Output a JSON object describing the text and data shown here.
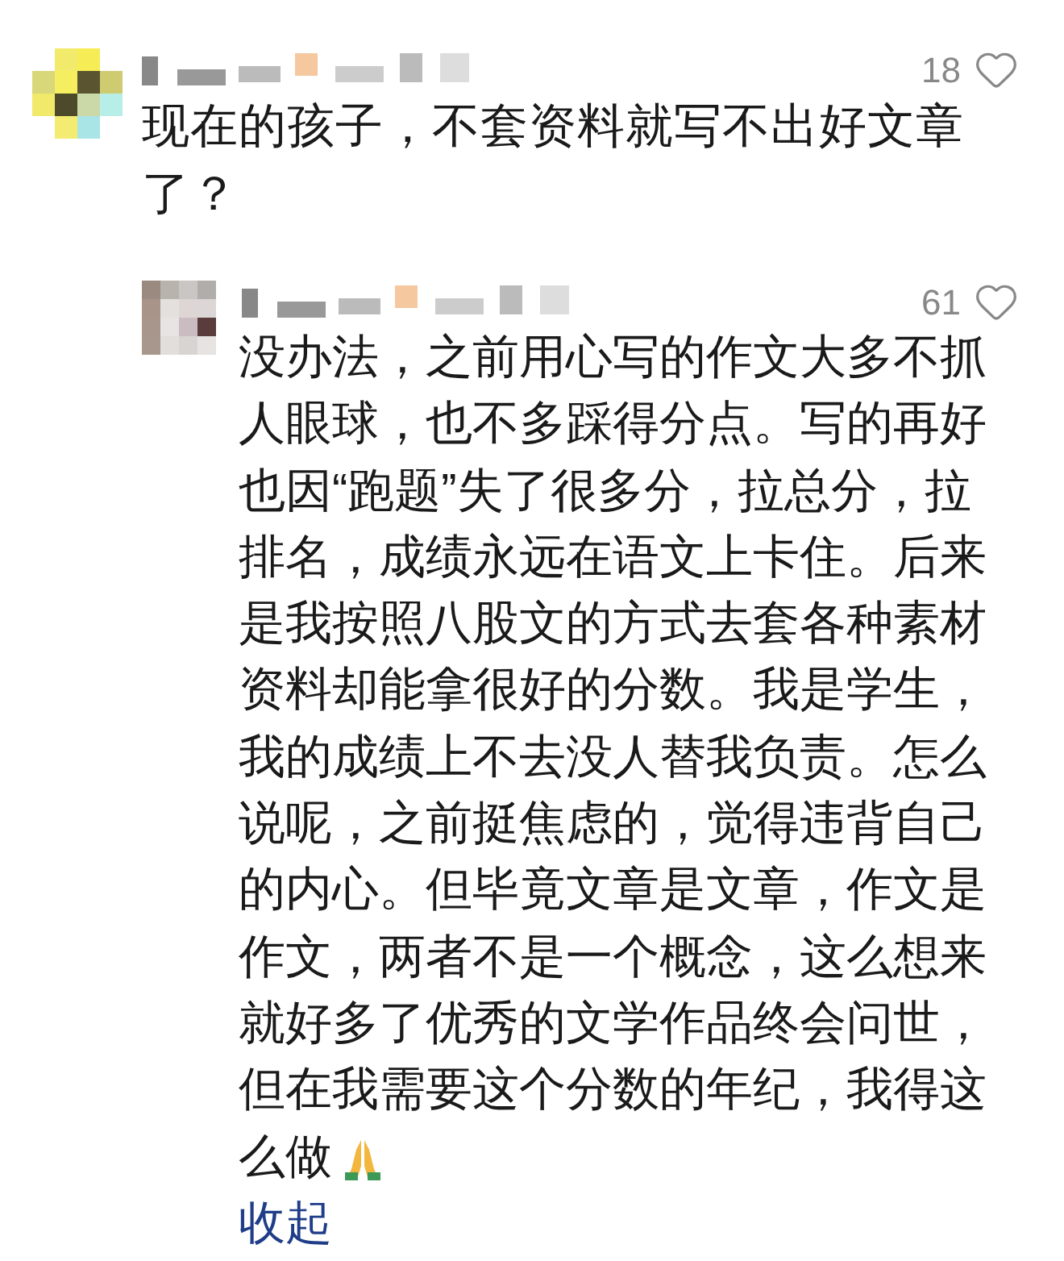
{
  "comment": {
    "likes": "18",
    "text": "现在的孩子，不套资料就写不出好文章了？",
    "reply": {
      "likes": "61",
      "text": "没办法，之前用心写的作文大多不抓人眼球，也不多踩得分点。写的再好也因“跑题”失了很多分，拉总分，拉排名，成绩永远在语文上卡住。后来是我按照八股文的方式去套各种素材资料却能拿很好的分数。我是学生，我的成绩上不去没人替我负责。怎么说呢，之前挺焦虑的，觉得违背自己的内心。但毕竟文章是文章，作文是作文，两者不是一个概念，这么想来就好多了优秀的文学作品终会问世，但在我需要这个分数的年纪，我得这",
      "text_end": "么做",
      "collapse": "收起"
    }
  }
}
